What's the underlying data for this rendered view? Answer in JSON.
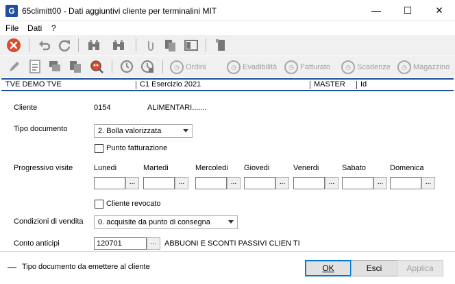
{
  "window": {
    "app_icon": "G",
    "title": "65climitt00 - Dati aggiuntivi cliente per terminalini MIT",
    "minimize_glyph": "—",
    "maximize_glyph": "☐",
    "close_glyph": "✕"
  },
  "menu": {
    "items": [
      "File",
      "Dati",
      "?"
    ]
  },
  "toolbar2": {
    "buttons": [
      "Ordini",
      "Evadibilità",
      "Fatturato",
      "Scadenze",
      "Magazzino"
    ]
  },
  "info": {
    "company": "TVE DEMO TVE",
    "fiscal_year": "C1 Esercizio 2021",
    "user": "MASTER",
    "id_label": "Id"
  },
  "form": {
    "cliente": {
      "label": "Cliente",
      "code": "0154",
      "name": "ALIMENTARI......."
    },
    "tipo_documento": {
      "label": "Tipo documento",
      "value": "2. Bolla valorizzata"
    },
    "punto_fatturazione": {
      "label": "Punto fatturazione",
      "checked": false
    },
    "progressivo_visite": {
      "label": "Progressivo visite",
      "days": [
        "Lunedi",
        "Martedi",
        "Mercoledi",
        "Giovedi",
        "Venerdi",
        "Sabato",
        "Domenica"
      ],
      "values": [
        "",
        "",
        "",
        "",
        "",
        "",
        ""
      ],
      "button_label": "..."
    },
    "cliente_revocato": {
      "label": "Cliente revocato",
      "checked": false
    },
    "condizioni_vendita": {
      "label": "Condizioni di vendita",
      "value": "0. acquisite da punto di consegna"
    },
    "conto_anticipi": {
      "label": "Conto anticipi",
      "code": "120701",
      "button_label": "...",
      "description": "ABBUONI E SCONTI PASSIVI CLIEN TI"
    }
  },
  "footer": {
    "legend_text": "Tipo documento da emettere al cliente",
    "legend_color": "#31c13b",
    "ok_label": "OK",
    "esci_label": "Esci",
    "applica_label": "Applica"
  },
  "colors": {
    "accent": "#1e4f9c",
    "close_red": "#e2492b"
  }
}
